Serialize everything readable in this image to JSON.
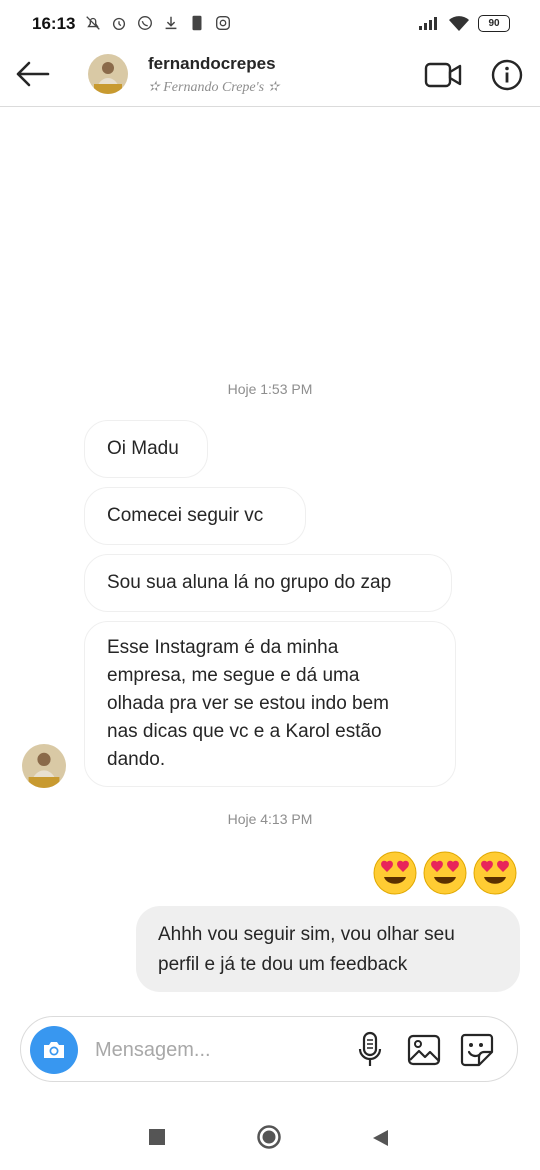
{
  "status_bar": {
    "time": "16:13",
    "battery": "90",
    "icons": [
      "mute-notifications-icon",
      "alarm-icon",
      "whatsapp-icon",
      "download-icon",
      "phone-icon",
      "instagram-icon",
      "signal-icon",
      "wifi-icon",
      "battery-icon"
    ]
  },
  "header": {
    "username": "fernandocrepes",
    "subtitle": "✫ Fernando Crepe's ✫",
    "icons": [
      "back-arrow-icon",
      "video-call-icon",
      "info-icon"
    ]
  },
  "conversation": {
    "timestamp_1": "Hoje 1:53 PM",
    "incoming": [
      "Oi Madu",
      "Comecei seguir vc",
      "Sou sua aluna lá no grupo do zap",
      [
        "Esse Instagram é da minha",
        "empresa, me segue e dá uma",
        "olhada pra ver se estou indo bem",
        "nas dicas que vc e a Karol estão",
        "dando."
      ]
    ],
    "timestamp_2": "Hoje 4:13 PM",
    "outgoing_emojis": [
      "😍",
      "😍",
      "😍"
    ],
    "outgoing_message": [
      "Ahhh vou seguir sim, vou olhar seu",
      "perfil e já te dou um feedback"
    ]
  },
  "composer": {
    "placeholder": "Mensagem...",
    "value": "",
    "icons": [
      "camera-icon",
      "microphone-icon",
      "gallery-icon",
      "sticker-icon"
    ]
  },
  "navigation": {
    "icons": [
      "recents-square-icon",
      "home-circle-icon",
      "back-triangle-icon"
    ]
  },
  "colors": {
    "accent": "#3897f0",
    "bubble_out": "#efefef",
    "border": "#dbdbdb",
    "muted_text": "#8e8e8e"
  }
}
